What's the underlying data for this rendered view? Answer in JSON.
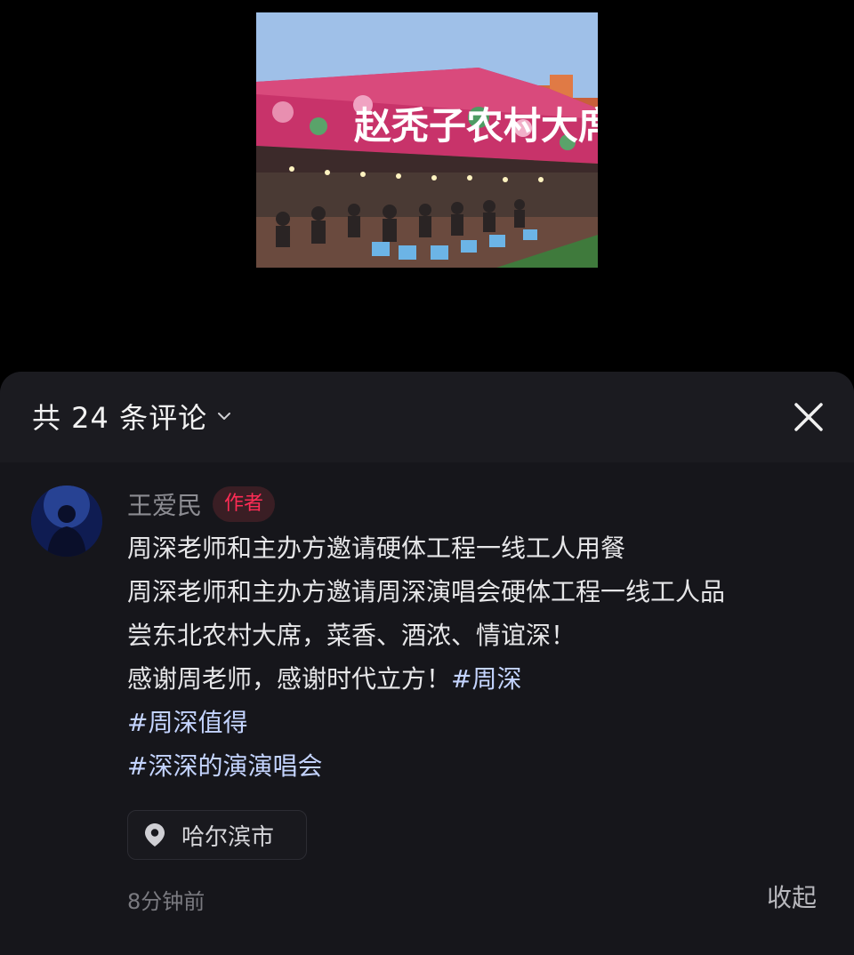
{
  "photo": {
    "sign_text": "赵秃子农村大席"
  },
  "header": {
    "title": "共 24 条评论"
  },
  "comment": {
    "author": "王爱民",
    "badge": "作者",
    "lines": [
      {
        "text": "周深老师和主办方邀请硬体工程一线工人用餐",
        "tag": ""
      },
      {
        "text": "周深老师和主办方邀请周深演唱会硬体工程一线工人品",
        "tag": ""
      },
      {
        "text": "尝东北农村大席，菜香、酒浓、情谊深！",
        "tag": ""
      },
      {
        "text": "感谢周老师，感谢时代立方！",
        "tag": "#周深"
      },
      {
        "text": "",
        "tag": "#周深值得"
      },
      {
        "text": "",
        "tag": "#深深的演演唱会"
      }
    ],
    "location": "哈尔滨市",
    "time": "8分钟前",
    "collapse_label": "收起"
  },
  "colors": {
    "sheet_bg": "#16161b",
    "header_bg": "#1b1b20",
    "hashtag": "#c4d4ff",
    "badge_text": "#fe2c55",
    "badge_bg": "#3a1e24"
  },
  "icons": {
    "chevron": "chevron-down-icon",
    "close": "close-icon",
    "location": "location-pin-icon"
  }
}
